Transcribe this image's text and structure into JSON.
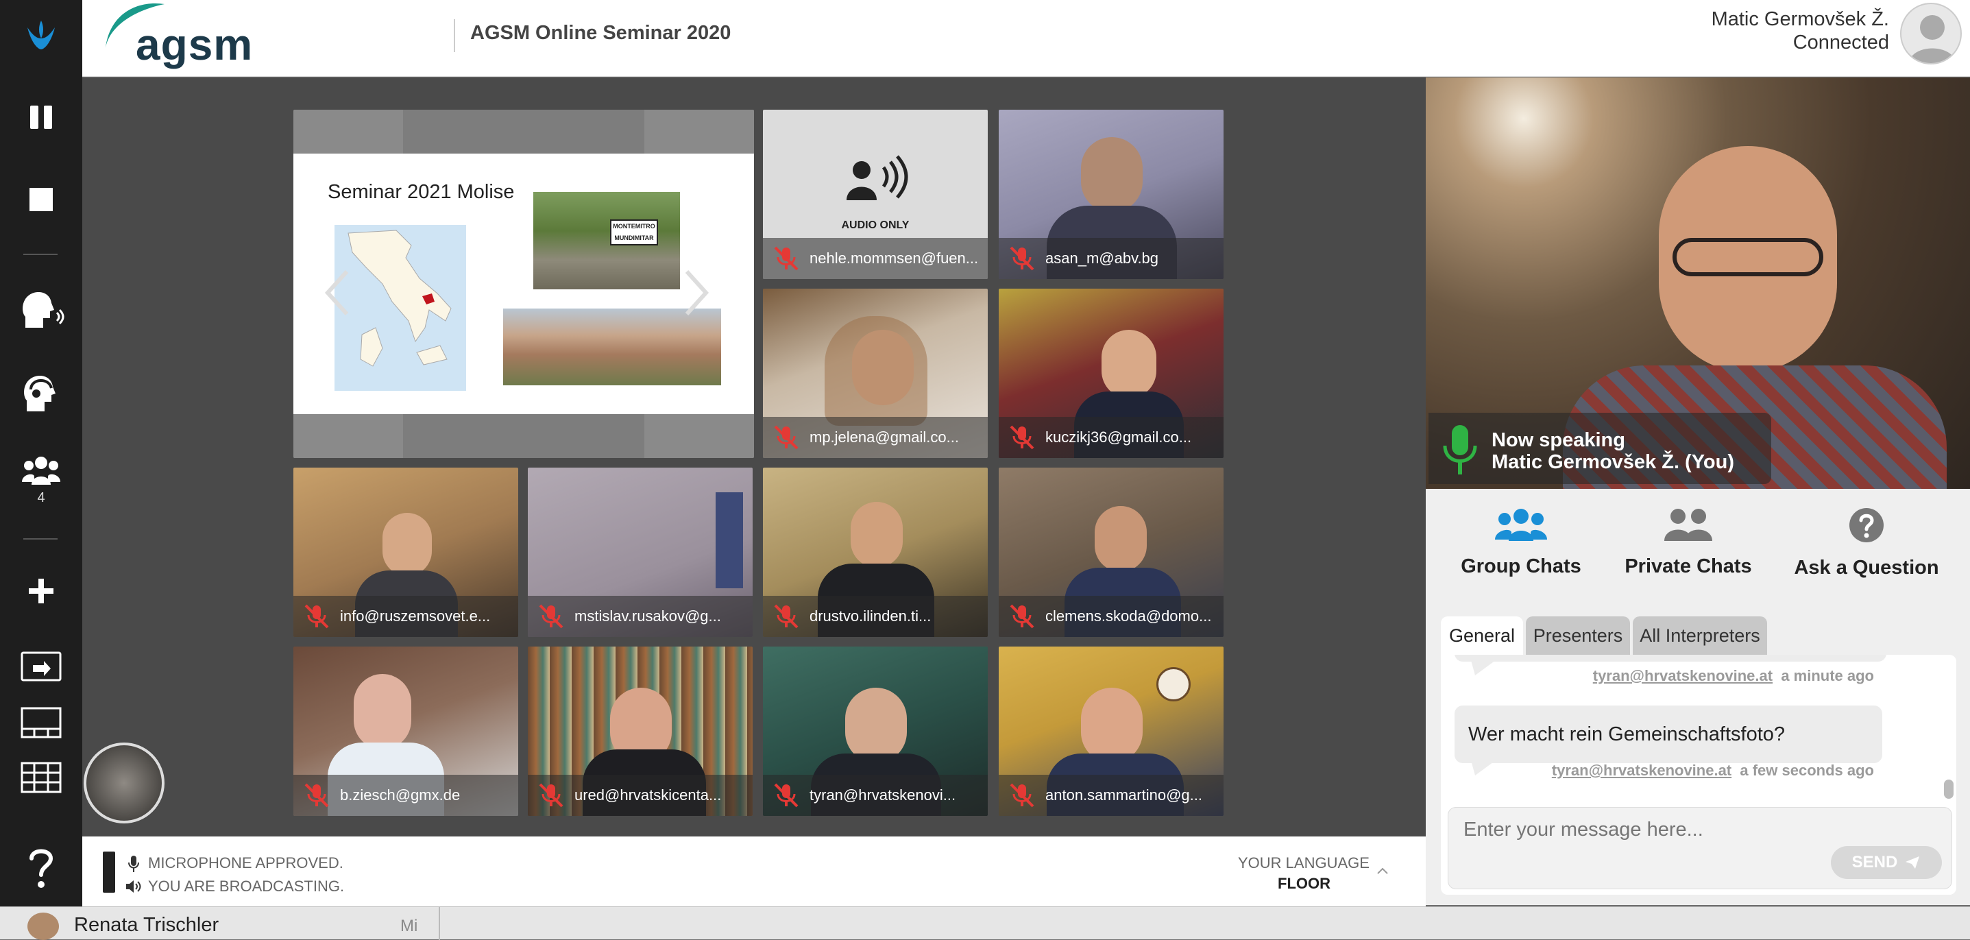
{
  "header": {
    "logo": "agsm",
    "event_title": "AGSM Online Seminar 2020",
    "user_name": "Matic Germovšek Ž.",
    "user_status": "Connected"
  },
  "rail": {
    "participant_count": "4"
  },
  "slide": {
    "title_prefix": "Seminar",
    "title_rest": "2021 Molise",
    "sign_line1": "MONTEMITRO",
    "sign_line2": "MUNDIMITAR"
  },
  "tiles": [
    {
      "name": "nehle.mommsen@fuen...",
      "audio_only": "AUDIO ONLY"
    },
    {
      "name": "asan_m@abv.bg"
    },
    {
      "name": "mp.jelena@gmail.co..."
    },
    {
      "name": "kuczikj36@gmail.co..."
    },
    {
      "name": "info@ruszemsovet.e..."
    },
    {
      "name": "mstislav.rusakov@g..."
    },
    {
      "name": "drustvo.ilinden.ti..."
    },
    {
      "name": "clemens.skoda@domo..."
    },
    {
      "name": "b.ziesch@gmx.de"
    },
    {
      "name": "ured@hrvatskicenta..."
    },
    {
      "name": "tyran@hrvatskenovi..."
    },
    {
      "name": "anton.sammartino@g..."
    }
  ],
  "footer": {
    "mic_status": "MICROPHONE APPROVED.",
    "broadcast_status": "YOU ARE BROADCASTING.",
    "language_label": "YOUR LANGUAGE",
    "language_value": "FLOOR"
  },
  "speaking": {
    "label": "Now speaking",
    "name": "Matic Germovšek Ž. (You)"
  },
  "chat_nav": {
    "group": "Group Chats",
    "private": "Private Chats",
    "ask": "Ask a Question"
  },
  "chat_tabs": [
    "General",
    "Presenters",
    "All Interpreters"
  ],
  "messages": [
    {
      "author": "tyran@hrvatskenovine.at",
      "time": "a minute ago"
    },
    {
      "text": "Wer macht rein Gemeinschaftsfoto?",
      "author": "tyran@hrvatskenovine.at",
      "time": "a few seconds ago"
    }
  ],
  "composer": {
    "placeholder": "Enter your message here...",
    "send": "SEND"
  },
  "bottom": {
    "name": "Renata Trischler",
    "day": "Mi"
  },
  "colors": {
    "accent": "#1a8fd6",
    "rail": "#1e1e1e",
    "stage": "#4a4a4a",
    "muted_red": "#e53935",
    "speaking_green": "#2fb344"
  }
}
